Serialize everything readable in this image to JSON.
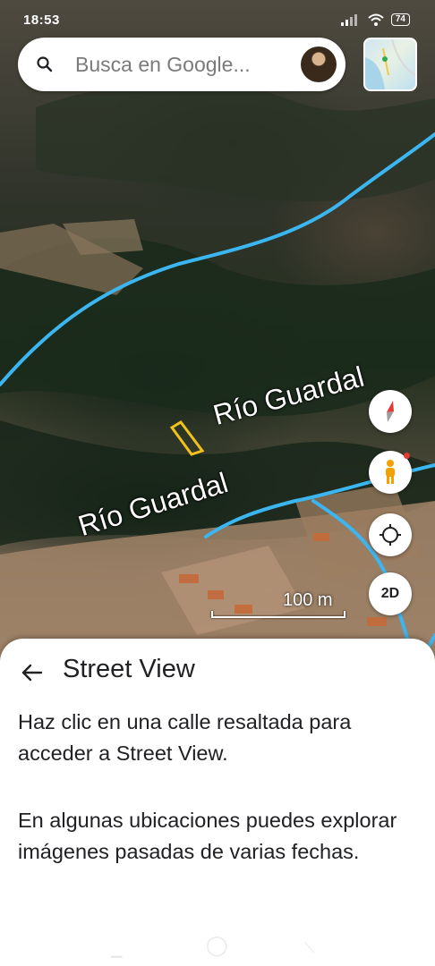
{
  "status_bar": {
    "time": "18:53",
    "battery": "74"
  },
  "search": {
    "placeholder": "Busca en Google..."
  },
  "map": {
    "river_labels": [
      "Río Guardal",
      "Río Guardal"
    ],
    "scale": "100 m",
    "toggle_label": "2D"
  },
  "panel": {
    "title": "Street View",
    "paragraph1": "Haz clic en una calle resaltada para acceder a Street View.",
    "paragraph2": "En algunas ubicaciones puedes explorar imágenes pasadas de varias fechas."
  },
  "colors": {
    "street_view_line": "#3cb6f0",
    "parcel_outline": "#f2c21b",
    "compass_needle": "#e53935",
    "pegman": "#f4a000"
  }
}
